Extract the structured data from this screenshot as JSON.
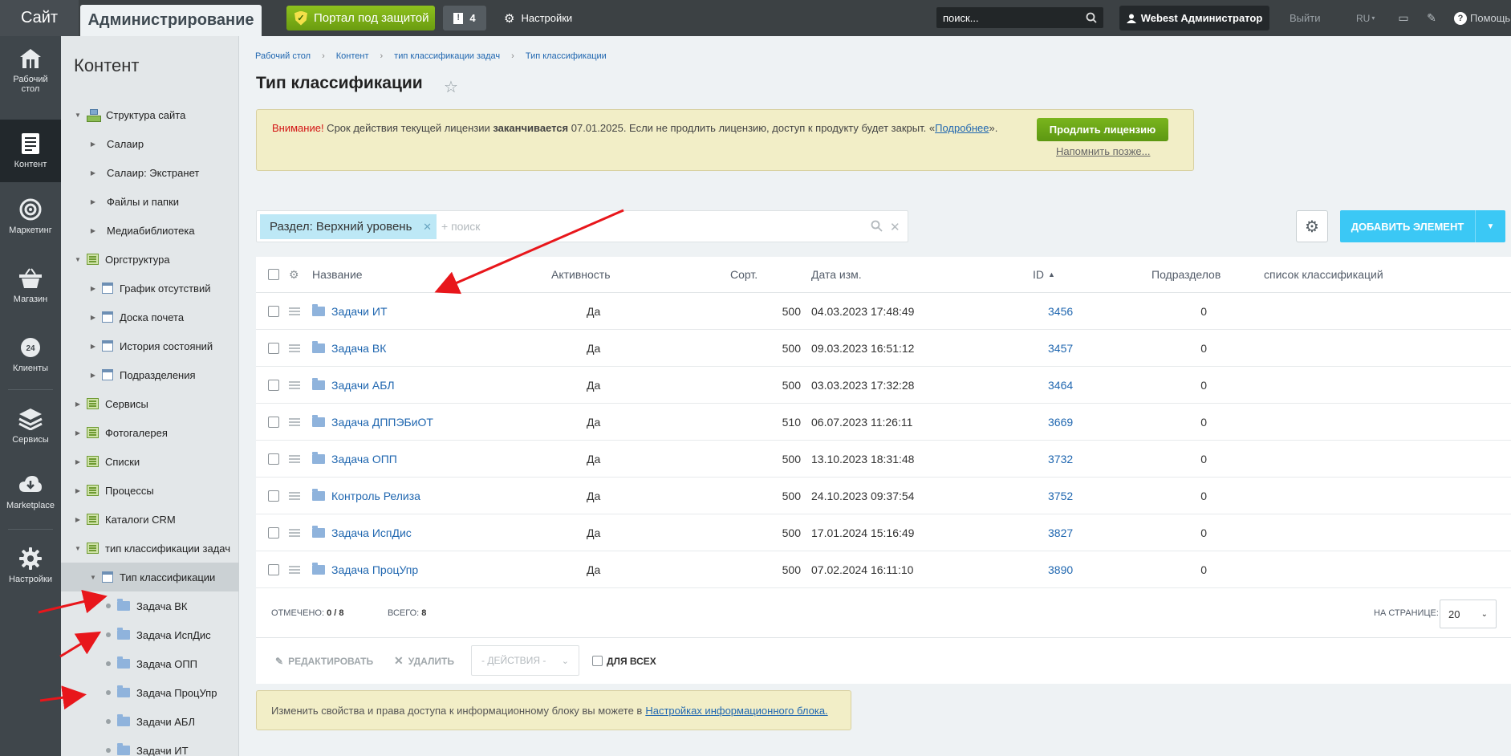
{
  "topbar": {
    "site": "Сайт",
    "admin": "Администрирование",
    "portal": "Портал под защитой",
    "notif_count": "4",
    "settings": "Настройки",
    "search_value": "поиск...",
    "user": "Webest Администратор",
    "logout": "Выйти",
    "lang": "RU",
    "help": "Помощь"
  },
  "rail": [
    {
      "label": "Рабочий стол",
      "icon": "home-icon"
    },
    {
      "label": "Контент",
      "icon": "document-icon"
    },
    {
      "label": "Маркетинг",
      "icon": "target-icon"
    },
    {
      "label": "Магазин",
      "icon": "basket-icon"
    },
    {
      "label": "Клиенты",
      "icon": "clock-24-icon"
    },
    {
      "label": "Сервисы",
      "icon": "layers-icon"
    },
    {
      "label": "Marketplace",
      "icon": "cloud-download-icon"
    },
    {
      "label": "Настройки",
      "icon": "gear-icon"
    }
  ],
  "tree": {
    "title": "Контент",
    "items": [
      {
        "label": "Структура сайта",
        "level": 0,
        "expand": "open",
        "icon": "structure"
      },
      {
        "label": "Салаир",
        "level": 1,
        "expand": "closed",
        "icon": "none"
      },
      {
        "label": "Салаир: Экстранет",
        "level": 1,
        "expand": "closed",
        "icon": "none"
      },
      {
        "label": "Файлы и папки",
        "level": 1,
        "expand": "closed",
        "icon": "none"
      },
      {
        "label": "Медиабиблиотека",
        "level": 1,
        "expand": "closed",
        "icon": "none"
      },
      {
        "label": "Оргструктура",
        "level": 0,
        "expand": "open",
        "icon": "green"
      },
      {
        "label": "График отсутствий",
        "level": 1,
        "expand": "closed",
        "icon": "doc"
      },
      {
        "label": "Доска почета",
        "level": 1,
        "expand": "closed",
        "icon": "doc"
      },
      {
        "label": "История состояний",
        "level": 1,
        "expand": "closed",
        "icon": "doc"
      },
      {
        "label": "Подразделения",
        "level": 1,
        "expand": "closed",
        "icon": "doc"
      },
      {
        "label": "Сервисы",
        "level": 0,
        "expand": "closed",
        "icon": "green"
      },
      {
        "label": "Фотогалерея",
        "level": 0,
        "expand": "closed",
        "icon": "green"
      },
      {
        "label": "Списки",
        "level": 0,
        "expand": "closed",
        "icon": "green"
      },
      {
        "label": "Процессы",
        "level": 0,
        "expand": "closed",
        "icon": "green"
      },
      {
        "label": "Каталоги CRM",
        "level": 0,
        "expand": "closed",
        "icon": "green"
      },
      {
        "label": "тип классификации задач",
        "level": 0,
        "expand": "open",
        "icon": "green"
      },
      {
        "label": "Тип классификации",
        "level": 1,
        "expand": "open",
        "icon": "doc"
      },
      {
        "label": "Задача ВК",
        "level": 2,
        "expand": "dot",
        "icon": "folder"
      },
      {
        "label": "Задача ИспДис",
        "level": 2,
        "expand": "dot",
        "icon": "folder"
      },
      {
        "label": "Задача ОПП",
        "level": 2,
        "expand": "dot",
        "icon": "folder"
      },
      {
        "label": "Задача ПроцУпр",
        "level": 2,
        "expand": "dot",
        "icon": "folder"
      },
      {
        "label": "Задачи АБЛ",
        "level": 2,
        "expand": "dot",
        "icon": "folder"
      },
      {
        "label": "Задачи ИТ",
        "level": 2,
        "expand": "dot",
        "icon": "folder"
      }
    ]
  },
  "breadcrumb": [
    "Рабочий стол",
    "Контент",
    "тип классификации задач",
    "Тип классификации"
  ],
  "page_title": "Тип классификации",
  "license": {
    "warn": "Внимание!",
    "text1": " Срок действия текущей лицензии ",
    "bold": "заканчивается",
    "text2": " 07.01.2025. Если не продлить лицензию, доступ к продукту будет закрыт. «",
    "link": "Подробнее",
    "text3": "».",
    "renew": "Продлить лицензию",
    "remind": "Напомнить позже..."
  },
  "filter": {
    "chip": "Раздел: Верхний уровень",
    "placeholder": "+ поиск"
  },
  "add_button": "ДОБАВИТЬ ЭЛЕМЕНТ",
  "grid": {
    "columns": {
      "name": "Название",
      "active": "Активность",
      "sort": "Сорт.",
      "date": "Дата изм.",
      "id": "ID",
      "subsections": "Подразделов",
      "list": "список классификаций"
    },
    "rows": [
      {
        "name": "Задачи ИТ",
        "active": "Да",
        "sort": "500",
        "date": "04.03.2023 17:48:49",
        "id": "3456",
        "sub": "0"
      },
      {
        "name": "Задача ВК",
        "active": "Да",
        "sort": "500",
        "date": "09.03.2023 16:51:12",
        "id": "3457",
        "sub": "0"
      },
      {
        "name": "Задачи АБЛ",
        "active": "Да",
        "sort": "500",
        "date": "03.03.2023 17:32:28",
        "id": "3464",
        "sub": "0"
      },
      {
        "name": "Задача ДППЭБиОТ",
        "active": "Да",
        "sort": "510",
        "date": "06.07.2023 11:26:11",
        "id": "3669",
        "sub": "0"
      },
      {
        "name": "Задача ОПП",
        "active": "Да",
        "sort": "500",
        "date": "13.10.2023 18:31:48",
        "id": "3732",
        "sub": "0"
      },
      {
        "name": "Контроль Релиза",
        "active": "Да",
        "sort": "500",
        "date": "24.10.2023 09:37:54",
        "id": "3752",
        "sub": "0"
      },
      {
        "name": "Задача ИспДис",
        "active": "Да",
        "sort": "500",
        "date": "17.01.2024 15:16:49",
        "id": "3827",
        "sub": "0"
      },
      {
        "name": "Задача ПроцУпр",
        "active": "Да",
        "sort": "500",
        "date": "07.02.2024 16:11:10",
        "id": "3890",
        "sub": "0"
      }
    ],
    "footer": {
      "checked_label": "ОТМЕЧЕНО:",
      "checked_value": "0 / 8",
      "total_label": "ВСЕГО:",
      "total_value": "8",
      "per_page_label": "НА СТРАНИЦЕ:",
      "per_page_value": "20"
    },
    "actions": {
      "edit": "РЕДАКТИРОВАТЬ",
      "delete": "УДАЛИТЬ",
      "select": "- ДЕЙСТВИЯ -",
      "for_all": "ДЛЯ ВСЕХ"
    }
  },
  "info": {
    "text": "Изменить свойства и права доступа к информационному блоку вы можете в",
    "link": "Настройках информационного блока."
  },
  "colors": {
    "accent": "#3bc8f5",
    "green": "#7ab51d",
    "link": "#2067b0",
    "annotation": "#e8161b"
  }
}
